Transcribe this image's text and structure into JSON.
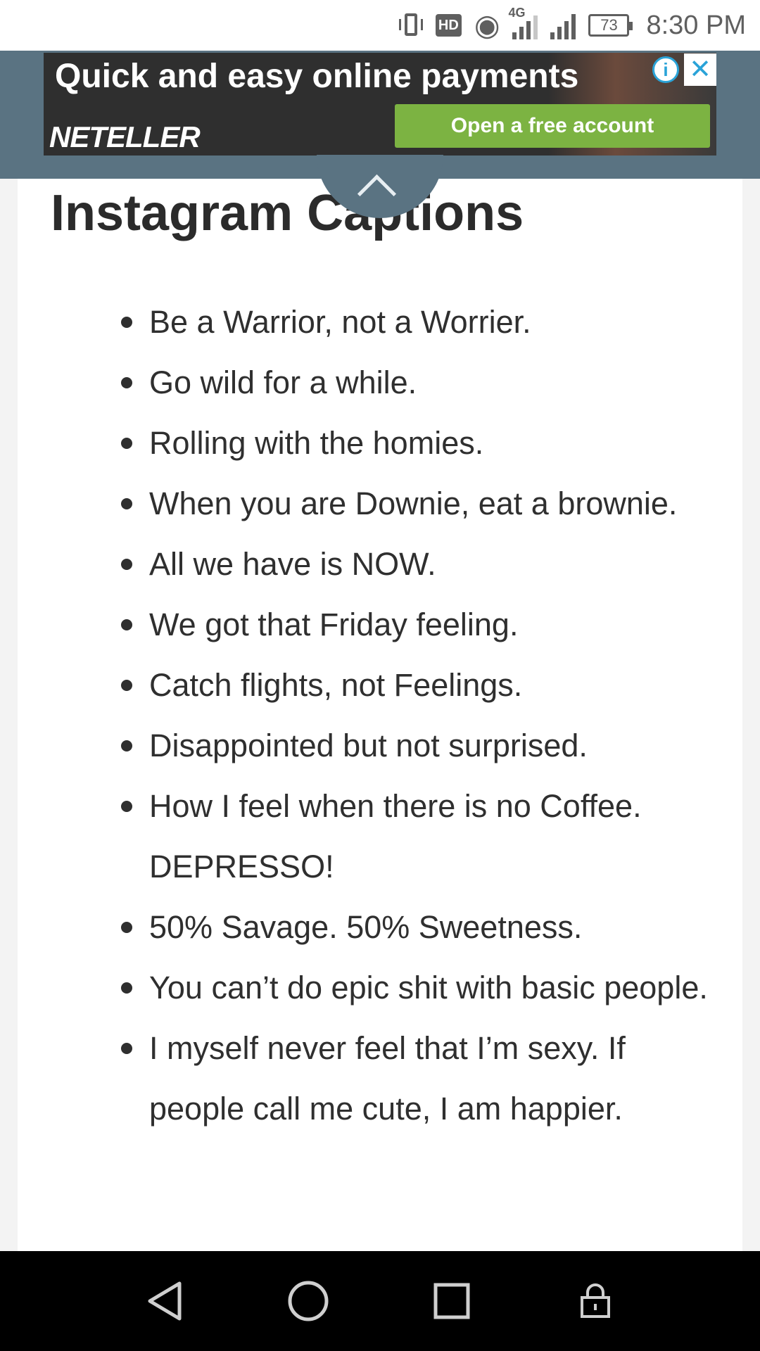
{
  "status_bar": {
    "hd_label": "HD",
    "network_label": "4G",
    "battery_level": "73",
    "time": "8:30 PM"
  },
  "ad": {
    "headline": "Quick and easy online payments",
    "brand": "NETELLER",
    "cta_label": "Open a free account",
    "info_icon": "info-icon",
    "close_icon": "close-icon"
  },
  "page": {
    "title": "Instagram Captions",
    "captions": [
      "Be a Warrior, not a Worrier.",
      "Go wild for a while.",
      "Rolling with the homies.",
      "When you are Downie, eat a brownie.",
      "All we have is NOW.",
      "We got that Friday feeling.",
      "Catch flights, not Feelings.",
      "Disappointed but not surprised.",
      "How I feel when there is no Coffee. DEPRESSO!",
      "50% Savage. 50% Sweetness.",
      "You can’t do epic shit with basic people.",
      "I myself never feel that I’m sexy. If people call me cute, I am happier."
    ]
  },
  "nav_bar": {
    "icons": [
      "back-icon",
      "home-icon",
      "recents-icon",
      "lock-icon"
    ]
  },
  "colors": {
    "header_bg": "#5a7382",
    "cta_green": "#7cb342",
    "info_blue": "#2aa3d8",
    "text_dark": "#2f2f2f"
  }
}
